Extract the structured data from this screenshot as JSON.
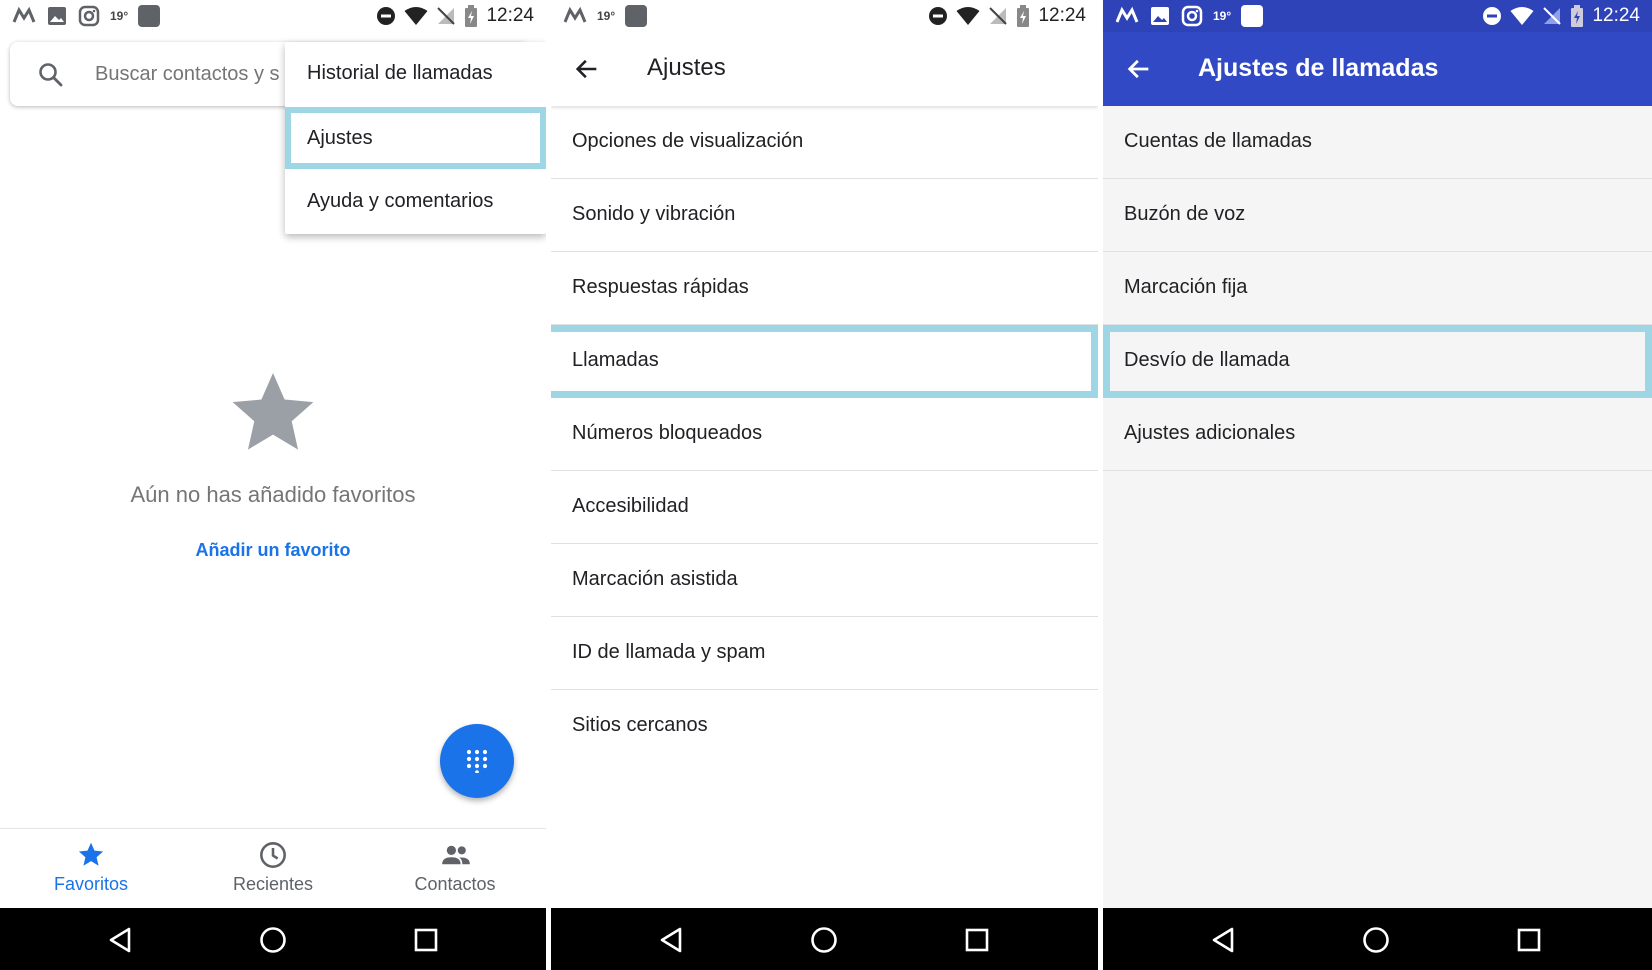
{
  "colors": {
    "accent_blue": "#1a73e8",
    "appbar_blue": "#3249c5",
    "highlight": "#9fd6e5"
  },
  "status_bar": {
    "time": "12:24",
    "temperature": "19°"
  },
  "panel1": {
    "search_placeholder": "Buscar contactos y s",
    "overflow_menu": [
      {
        "label": "Historial de llamadas"
      },
      {
        "label": "Ajustes",
        "highlighted": true
      },
      {
        "label": "Ayuda y comentarios"
      }
    ],
    "empty_state": {
      "message": "Aún no has añadido favoritos",
      "action": "Añadir un favorito"
    },
    "bottom_nav": [
      {
        "label": "Favoritos",
        "icon": "star-icon",
        "active": true
      },
      {
        "label": "Recientes",
        "icon": "clock-icon",
        "active": false
      },
      {
        "label": "Contactos",
        "icon": "people-icon",
        "active": false
      }
    ]
  },
  "panel2": {
    "title": "Ajustes",
    "items": [
      {
        "label": "Opciones de visualización"
      },
      {
        "label": "Sonido y vibración"
      },
      {
        "label": "Respuestas rápidas"
      },
      {
        "label": "Llamadas",
        "highlighted": true
      },
      {
        "label": "Números bloqueados"
      },
      {
        "label": "Accesibilidad"
      },
      {
        "label": "Marcación asistida"
      },
      {
        "label": "ID de llamada y spam"
      },
      {
        "label": "Sitios cercanos"
      }
    ]
  },
  "panel3": {
    "title": "Ajustes de llamadas",
    "items": [
      {
        "label": "Cuentas de llamadas"
      },
      {
        "label": "Buzón de voz"
      },
      {
        "label": "Marcación fija"
      },
      {
        "label": "Desvío de llamada",
        "highlighted": true
      },
      {
        "label": "Ajustes adicionales"
      }
    ]
  }
}
